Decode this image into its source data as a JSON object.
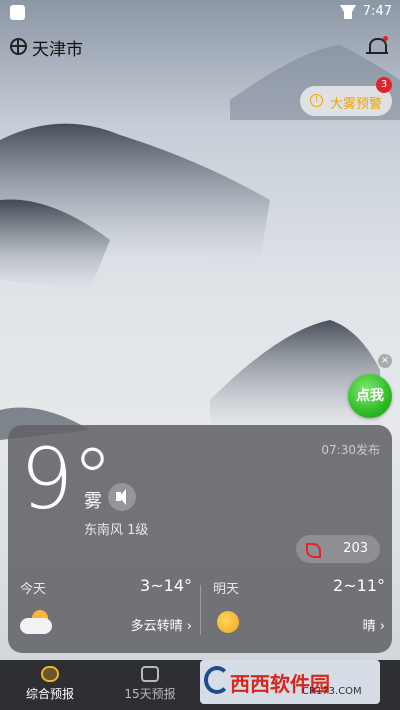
{
  "status": {
    "time": "7:47"
  },
  "header": {
    "city": "天津市"
  },
  "alert": {
    "label": "大雾预警",
    "badge": "3",
    "icon": "warning-icon"
  },
  "ad": {
    "label": "点我",
    "close": "×"
  },
  "current": {
    "temperature": "9°",
    "condition": "雾",
    "wind": "东南风 1级",
    "published": "07:30发布",
    "aqi": "203"
  },
  "forecast": {
    "today": {
      "name": "今天",
      "range": "3~14°",
      "desc": "多云转晴 ›",
      "icon": "partly-cloudy-icon"
    },
    "tomorrow": {
      "name": "明天",
      "range": "2~11°",
      "desc": "晴 ›",
      "icon": "sunny-icon"
    }
  },
  "nav": [
    {
      "label": "综合预报",
      "active": true
    },
    {
      "label": "15天预报",
      "active": false
    },
    {
      "label": "",
      "active": false
    },
    {
      "label": "",
      "active": false
    }
  ],
  "colors": {
    "accent": "#f0b32a",
    "alert": "#f0a500",
    "badge": "#e3222b",
    "ad": "#2fbd26"
  }
}
